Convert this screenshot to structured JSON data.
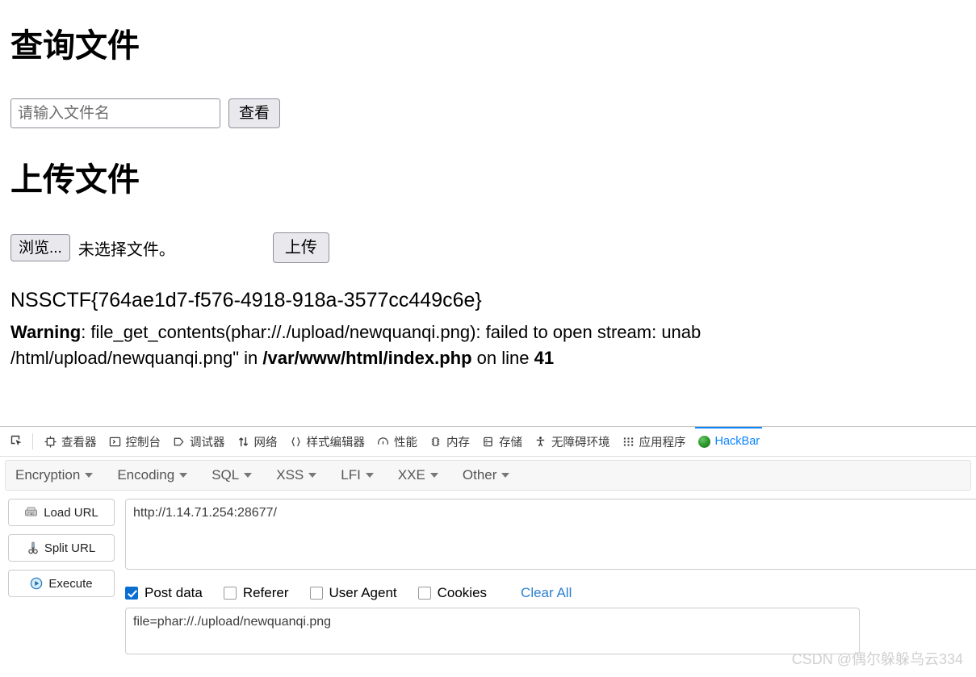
{
  "page": {
    "query_heading": "查询文件",
    "search_placeholder": "请输入文件名",
    "search_value": "",
    "view_button": "查看",
    "upload_heading": "上传文件",
    "browse_button": "浏览...",
    "no_file_text": "未选择文件。",
    "upload_button": "上传",
    "flag": "NSSCTF{764ae1d7-f576-4918-918a-3577cc449c6e}",
    "warning": {
      "label": "Warning",
      "line1_a": ": file_get_contents(phar://./upload/newquanqi.png): failed to open stream: unab",
      "line2_a": "/html/upload/newquanqi.png\" in ",
      "line2_path": "/var/www/html/index.php",
      "line2_b": " on line ",
      "line2_num": "41"
    }
  },
  "devtools": {
    "picker_icon": "element-picker-icon",
    "tabs": [
      {
        "label": "查看器",
        "icon": "inspector-icon",
        "active": false
      },
      {
        "label": "控制台",
        "icon": "console-icon",
        "active": false
      },
      {
        "label": "调试器",
        "icon": "debugger-icon",
        "active": false
      },
      {
        "label": "网络",
        "icon": "network-icon",
        "active": false
      },
      {
        "label": "样式编辑器",
        "icon": "style-editor-icon",
        "active": false
      },
      {
        "label": "性能",
        "icon": "performance-icon",
        "active": false
      },
      {
        "label": "内存",
        "icon": "memory-icon",
        "active": false
      },
      {
        "label": "存储",
        "icon": "storage-icon",
        "active": false
      },
      {
        "label": "无障碍环境",
        "icon": "accessibility-icon",
        "active": false
      },
      {
        "label": "应用程序",
        "icon": "application-icon",
        "active": false
      },
      {
        "label": "HackBar",
        "icon": "hackbar-icon",
        "active": true
      }
    ],
    "active_tab_color": "#0a84ff"
  },
  "hackbar": {
    "menu": [
      {
        "label": "Encryption"
      },
      {
        "label": "Encoding"
      },
      {
        "label": "SQL"
      },
      {
        "label": "XSS"
      },
      {
        "label": "LFI"
      },
      {
        "label": "XXE"
      },
      {
        "label": "Other"
      }
    ],
    "buttons": [
      {
        "label": "Load URL",
        "icon": "load-url-icon"
      },
      {
        "label": "Split URL",
        "icon": "scissors-icon"
      },
      {
        "label": "Execute",
        "icon": "play-icon"
      }
    ],
    "url_value": "http://1.14.71.254:28677/",
    "url_placeholder": "",
    "options": [
      {
        "label": "Post data",
        "checked": true
      },
      {
        "label": "Referer",
        "checked": false
      },
      {
        "label": "User Agent",
        "checked": false
      },
      {
        "label": "Cookies",
        "checked": false
      }
    ],
    "clear_all": "Clear All",
    "post_data_value": "file=phar://./upload/newquanqi.png",
    "post_data_placeholder": "",
    "link_color": "#2c7fd0"
  },
  "watermark": "CSDN @偶尔躲躲乌云334"
}
